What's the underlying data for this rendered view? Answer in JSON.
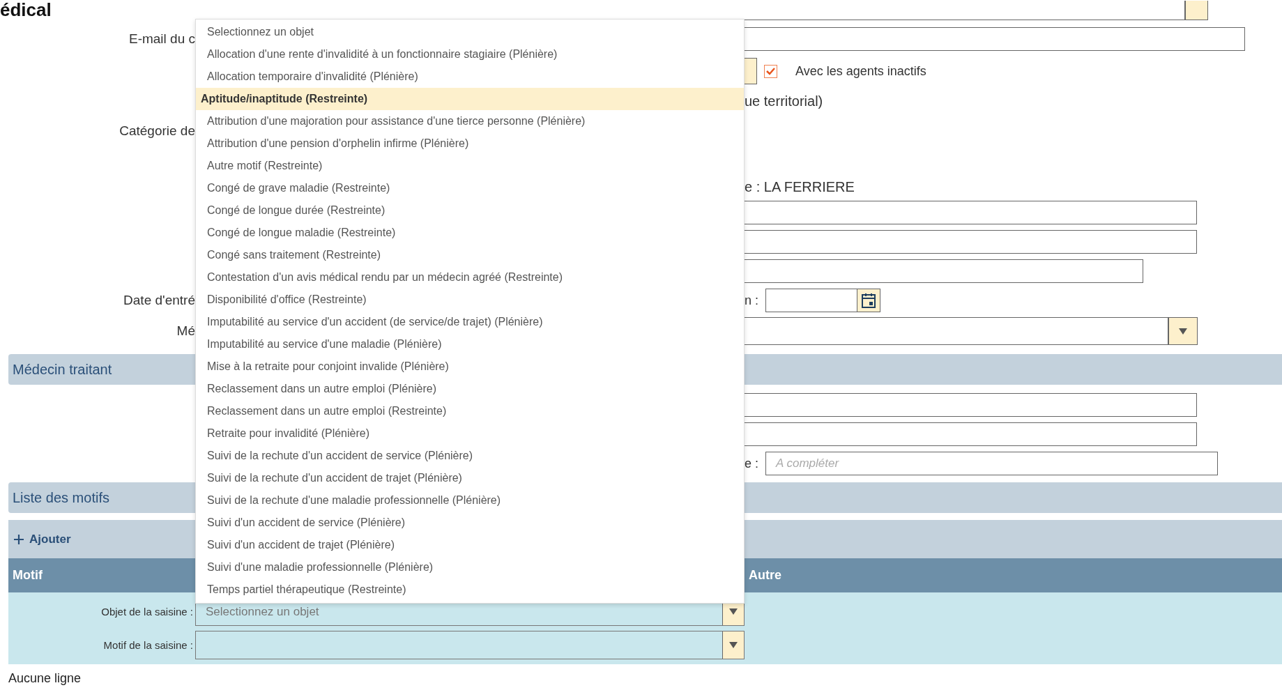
{
  "page_title": "édical",
  "form": {
    "email_label": "E-mail du c",
    "agent_filter": {
      "checked": true,
      "label": "Avec les agents inactifs"
    },
    "category_value": "ue territorial)",
    "category_label": "Catégorie de",
    "commune_value": "e : LA FERRIERE",
    "date_label": "Date d'entré",
    "date_suffix": "n :",
    "doctor_label": "Mé"
  },
  "doctor_section": {
    "title": "Médecin traitant",
    "field_suffix": "e :",
    "placeholder": "A compléter"
  },
  "motifs_section": {
    "title": "Liste des motifs",
    "add_button": "Ajouter",
    "columns": [
      "Motif",
      "Autre"
    ],
    "object_label": "Objet de la saisine :",
    "object_placeholder": "Selectionnez un objet",
    "motif_label": "Motif de la saisine :",
    "empty_text": "Aucune ligne"
  },
  "dropdown": {
    "items": [
      {
        "label": "Selectionnez un objet",
        "selected": false
      },
      {
        "label": "Allocation d'une rente d'invalidité à un fonctionnaire stagiaire (Plénière)",
        "selected": false
      },
      {
        "label": "Allocation temporaire d'invalidité (Plénière)",
        "selected": false
      },
      {
        "label": "Aptitude/inaptitude (Restreinte)",
        "selected": true
      },
      {
        "label": "Attribution d'une majoration pour assistance d'une tierce personne (Plénière)",
        "selected": false
      },
      {
        "label": "Attribution d'une pension d'orphelin infirme (Plénière)",
        "selected": false
      },
      {
        "label": "Autre motif (Restreinte)",
        "selected": false
      },
      {
        "label": "Congé de grave maladie (Restreinte)",
        "selected": false
      },
      {
        "label": "Congé de longue durée (Restreinte)",
        "selected": false
      },
      {
        "label": "Congé de longue maladie (Restreinte)",
        "selected": false
      },
      {
        "label": "Congé sans traitement (Restreinte)",
        "selected": false
      },
      {
        "label": "Contestation d'un avis médical rendu par un médecin agréé (Restreinte)",
        "selected": false
      },
      {
        "label": "Disponibilité d'office (Restreinte)",
        "selected": false
      },
      {
        "label": "Imputabilité au service d'un accident (de service/de trajet) (Plénière)",
        "selected": false
      },
      {
        "label": "Imputabilité au service d'une maladie (Plénière)",
        "selected": false
      },
      {
        "label": "Mise à la retraite pour conjoint invalide (Plénière)",
        "selected": false
      },
      {
        "label": "Reclassement dans un autre emploi (Plénière)",
        "selected": false
      },
      {
        "label": "Reclassement dans un autre emploi (Restreinte)",
        "selected": false
      },
      {
        "label": "Retraite pour invalidité (Plénière)",
        "selected": false
      },
      {
        "label": "Suivi de la rechute d'un accident de service (Plénière)",
        "selected": false
      },
      {
        "label": "Suivi de la rechute d'un accident de trajet (Plénière)",
        "selected": false
      },
      {
        "label": "Suivi de la rechute d'une maladie professionnelle (Plénière)",
        "selected": false
      },
      {
        "label": "Suivi d'un accident de service (Plénière)",
        "selected": false
      },
      {
        "label": "Suivi d'un accident de trajet (Plénière)",
        "selected": false
      },
      {
        "label": "Suivi d'une maladie professionnelle (Plénière)",
        "selected": false
      },
      {
        "label": "Temps partiel thérapeutique (Restreinte)",
        "selected": false
      }
    ]
  }
}
